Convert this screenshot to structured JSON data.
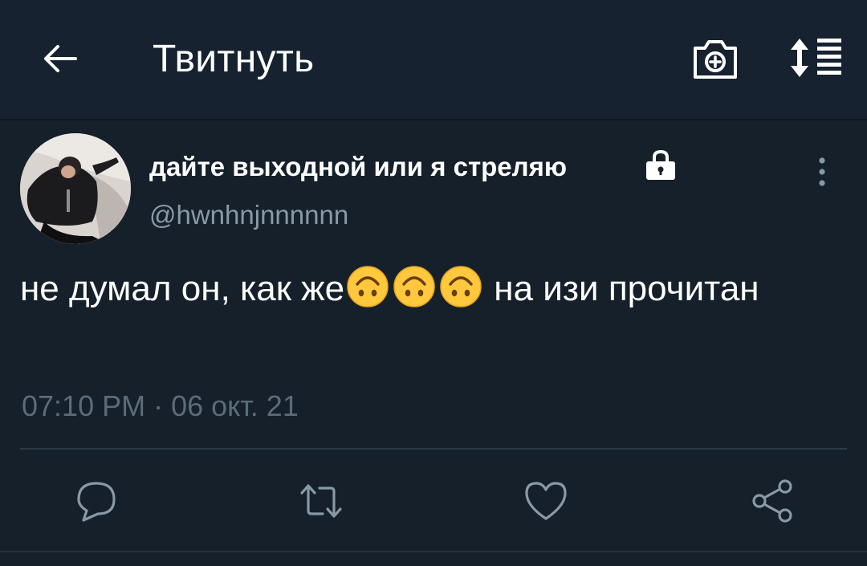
{
  "header": {
    "title": "Твитнуть",
    "back_icon": "arrow-left-icon",
    "camera_icon": "camera-add-icon",
    "sort_icon": "sort-list-icon"
  },
  "tweet": {
    "display_name": "дайте выходной или я стреляю",
    "protected_icon": "lock-icon",
    "handle": "@hwnhnjnnnnnn",
    "text_before": "не думал он, как же",
    "emoji": [
      "upside-down-face",
      "upside-down-face",
      "upside-down-face"
    ],
    "text_after": " на изи прочитан",
    "time": "07:10 PM · 06 окт. 21",
    "more_icon": "more-vertical-icon"
  },
  "actions": [
    {
      "name": "reply",
      "icon": "reply-icon"
    },
    {
      "name": "retweet",
      "icon": "retweet-icon"
    },
    {
      "name": "like",
      "icon": "heart-icon"
    },
    {
      "name": "share",
      "icon": "share-icon"
    }
  ],
  "colors": {
    "background": "#15202b",
    "header": "#172230",
    "text": "#ffffff",
    "secondary_text": "#8899a6",
    "icon": "#8899a6"
  }
}
